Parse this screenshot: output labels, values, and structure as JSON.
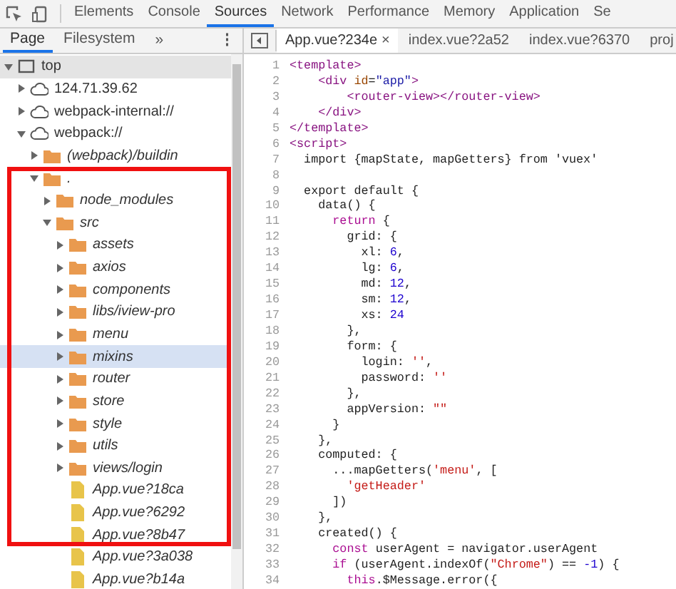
{
  "main_tabs": [
    {
      "label": "Elements",
      "selected": false
    },
    {
      "label": "Console",
      "selected": false
    },
    {
      "label": "Sources",
      "selected": true
    },
    {
      "label": "Network",
      "selected": false
    },
    {
      "label": "Performance",
      "selected": false
    },
    {
      "label": "Memory",
      "selected": false
    },
    {
      "label": "Application",
      "selected": false
    },
    {
      "label": "Se",
      "selected": false
    }
  ],
  "navigator_tabs": [
    {
      "label": "Page",
      "selected": true
    },
    {
      "label": "Filesystem",
      "selected": false
    }
  ],
  "navigator_more": "»",
  "navigator_menu": "⋮",
  "editor_tabs": [
    {
      "label": "App.vue?234e",
      "close": "×",
      "selected": true
    },
    {
      "label": "index.vue?2a52",
      "selected": false
    },
    {
      "label": "index.vue?6370",
      "selected": false
    },
    {
      "label": "proj",
      "selected": false
    }
  ],
  "tree": [
    {
      "name": "top",
      "kind": "frame",
      "italic": false,
      "expanded": true,
      "selected": false,
      "hovered": true,
      "children": [
        {
          "name": "124.71.39.62",
          "kind": "domain",
          "italic": false,
          "expanded": false,
          "selected": false,
          "hovered": false
        },
        {
          "name": "webpack-internal://",
          "kind": "domain",
          "italic": false,
          "expanded": false,
          "selected": false,
          "hovered": false
        },
        {
          "name": "webpack://",
          "kind": "domain",
          "italic": false,
          "expanded": true,
          "selected": false,
          "hovered": false,
          "children": [
            {
              "name": "(webpack)/buildin",
              "kind": "folder",
              "italic": true,
              "expanded": false,
              "selected": false,
              "hovered": false
            },
            {
              "name": ".",
              "kind": "folder",
              "italic": true,
              "expanded": true,
              "selected": false,
              "hovered": false,
              "children": [
                {
                  "name": "node_modules",
                  "kind": "folder",
                  "italic": true,
                  "expanded": false,
                  "selected": false,
                  "hovered": false
                },
                {
                  "name": "src",
                  "kind": "folder",
                  "italic": true,
                  "expanded": true,
                  "selected": false,
                  "hovered": false,
                  "children": [
                    {
                      "name": "assets",
                      "kind": "folder",
                      "italic": true,
                      "expanded": false,
                      "selected": false,
                      "hovered": false
                    },
                    {
                      "name": "axios",
                      "kind": "folder",
                      "italic": true,
                      "expanded": false,
                      "selected": false,
                      "hovered": false
                    },
                    {
                      "name": "components",
                      "kind": "folder",
                      "italic": true,
                      "expanded": false,
                      "selected": false,
                      "hovered": false
                    },
                    {
                      "name": "libs/iview-pro",
                      "kind": "folder",
                      "italic": true,
                      "expanded": false,
                      "selected": false,
                      "hovered": false
                    },
                    {
                      "name": "menu",
                      "kind": "folder",
                      "italic": true,
                      "expanded": false,
                      "selected": false,
                      "hovered": false
                    },
                    {
                      "name": "mixins",
                      "kind": "folder",
                      "italic": true,
                      "expanded": false,
                      "selected": true,
                      "hovered": false
                    },
                    {
                      "name": "router",
                      "kind": "folder",
                      "italic": true,
                      "expanded": false,
                      "selected": false,
                      "hovered": false
                    },
                    {
                      "name": "store",
                      "kind": "folder",
                      "italic": true,
                      "expanded": false,
                      "selected": false,
                      "hovered": false
                    },
                    {
                      "name": "style",
                      "kind": "folder",
                      "italic": true,
                      "expanded": false,
                      "selected": false,
                      "hovered": false
                    },
                    {
                      "name": "utils",
                      "kind": "folder",
                      "italic": true,
                      "expanded": false,
                      "selected": false,
                      "hovered": false
                    },
                    {
                      "name": "views/login",
                      "kind": "folder",
                      "italic": true,
                      "expanded": false,
                      "selected": false,
                      "hovered": false
                    },
                    {
                      "name": "App.vue?18ca",
                      "kind": "file",
                      "italic": true,
                      "selected": false,
                      "hovered": false
                    },
                    {
                      "name": "App.vue?6292",
                      "kind": "file",
                      "italic": true,
                      "selected": false,
                      "hovered": false
                    },
                    {
                      "name": "App.vue?8b47",
                      "kind": "file",
                      "italic": true,
                      "selected": false,
                      "hovered": false
                    },
                    {
                      "name": "App.vue?3a038",
                      "kind": "file",
                      "italic": true,
                      "selected": false,
                      "hovered": false
                    },
                    {
                      "name": "App.vue?b14a",
                      "kind": "file",
                      "italic": true,
                      "selected": false,
                      "hovered": false
                    }
                  ]
                }
              ]
            }
          ]
        }
      ]
    }
  ],
  "annotation": {
    "kind": "red_frame"
  },
  "code_lines": [
    {
      "number": "1",
      "tokens": [
        {
          "text": "<template>",
          "kind": "tag"
        }
      ]
    },
    {
      "number": "2",
      "tokens": [
        {
          "text": "    <div ",
          "kind": "tag"
        },
        {
          "text": "id",
          "kind": "attr"
        },
        {
          "text": "=",
          "kind": "plain"
        },
        {
          "text": "\"app\"",
          "kind": "value"
        },
        {
          "text": ">",
          "kind": "tag"
        }
      ]
    },
    {
      "number": "3",
      "tokens": [
        {
          "text": "        <router-view></router-view>",
          "kind": "tag"
        }
      ]
    },
    {
      "number": "4",
      "tokens": [
        {
          "text": "    </div>",
          "kind": "tag"
        }
      ]
    },
    {
      "number": "5",
      "tokens": [
        {
          "text": "</template>",
          "kind": "tag"
        }
      ]
    },
    {
      "number": "6",
      "tokens": [
        {
          "text": "<script>",
          "kind": "tag"
        }
      ]
    },
    {
      "number": "7",
      "tokens": [
        {
          "text": "  import {mapState, mapGetters} from 'vuex'",
          "kind": "plain"
        }
      ]
    },
    {
      "number": "8"
    },
    {
      "number": "9",
      "tokens": [
        {
          "text": "  export default {",
          "kind": "plain"
        }
      ]
    },
    {
      "number": "10",
      "tokens": [
        {
          "text": "    data() {",
          "kind": "plain"
        }
      ]
    },
    {
      "number": "11",
      "tokens": [
        {
          "text": "      return",
          "kind": "keyword"
        },
        {
          "text": " {",
          "kind": "plain"
        }
      ]
    },
    {
      "number": "12",
      "tokens": [
        {
          "text": "        grid: {",
          "kind": "plain"
        }
      ]
    },
    {
      "number": "13",
      "tokens": [
        {
          "text": "          xl: ",
          "kind": "plain"
        },
        {
          "text": "6",
          "kind": "number"
        },
        {
          "text": ",",
          "kind": "plain"
        }
      ]
    },
    {
      "number": "14",
      "tokens": [
        {
          "text": "          lg: ",
          "kind": "plain"
        },
        {
          "text": "6",
          "kind": "number"
        },
        {
          "text": ",",
          "kind": "plain"
        }
      ]
    },
    {
      "number": "15",
      "tokens": [
        {
          "text": "          md: ",
          "kind": "plain"
        },
        {
          "text": "12",
          "kind": "number"
        },
        {
          "text": ",",
          "kind": "plain"
        }
      ]
    },
    {
      "number": "16",
      "tokens": [
        {
          "text": "          sm: ",
          "kind": "plain"
        },
        {
          "text": "12",
          "kind": "number"
        },
        {
          "text": ",",
          "kind": "plain"
        }
      ]
    },
    {
      "number": "17",
      "tokens": [
        {
          "text": "          xs: ",
          "kind": "plain"
        },
        {
          "text": "24",
          "kind": "number"
        }
      ]
    },
    {
      "number": "18",
      "tokens": [
        {
          "text": "        },",
          "kind": "plain"
        }
      ]
    },
    {
      "number": "19",
      "tokens": [
        {
          "text": "        form: {",
          "kind": "plain"
        }
      ]
    },
    {
      "number": "20",
      "tokens": [
        {
          "text": "          login: ",
          "kind": "plain"
        },
        {
          "text": "''",
          "kind": "string"
        },
        {
          "text": ",",
          "kind": "plain"
        }
      ]
    },
    {
      "number": "21",
      "tokens": [
        {
          "text": "          password: ",
          "kind": "plain"
        },
        {
          "text": "''",
          "kind": "string"
        }
      ]
    },
    {
      "number": "22",
      "tokens": [
        {
          "text": "        },",
          "kind": "plain"
        }
      ]
    },
    {
      "number": "23",
      "tokens": [
        {
          "text": "        appVersion: ",
          "kind": "plain"
        },
        {
          "text": "\"\"",
          "kind": "string"
        }
      ]
    },
    {
      "number": "24",
      "tokens": [
        {
          "text": "      }",
          "kind": "plain"
        }
      ]
    },
    {
      "number": "25",
      "tokens": [
        {
          "text": "    },",
          "kind": "plain"
        }
      ]
    },
    {
      "number": "26",
      "tokens": [
        {
          "text": "    computed: {",
          "kind": "plain"
        }
      ]
    },
    {
      "number": "27",
      "tokens": [
        {
          "text": "      ...mapGetters(",
          "kind": "plain"
        },
        {
          "text": "'menu'",
          "kind": "string"
        },
        {
          "text": ", [",
          "kind": "plain"
        }
      ]
    },
    {
      "number": "28",
      "tokens": [
        {
          "text": "        'getHeader'",
          "kind": "string"
        }
      ]
    },
    {
      "number": "29",
      "tokens": [
        {
          "text": "      ])",
          "kind": "plain"
        }
      ]
    },
    {
      "number": "30",
      "tokens": [
        {
          "text": "    },",
          "kind": "plain"
        }
      ]
    },
    {
      "number": "31",
      "tokens": [
        {
          "text": "    created() {",
          "kind": "plain"
        }
      ]
    },
    {
      "number": "32",
      "tokens": [
        {
          "text": "      const",
          "kind": "keyword"
        },
        {
          "text": " userAgent = navigator.userAgent",
          "kind": "plain"
        }
      ]
    },
    {
      "number": "33",
      "tokens": [
        {
          "text": "      if",
          "kind": "keyword"
        },
        {
          "text": " (userAgent.indexOf(",
          "kind": "plain"
        },
        {
          "text": "\"Chrome\"",
          "kind": "string"
        },
        {
          "text": ") == ",
          "kind": "plain"
        },
        {
          "text": "-1",
          "kind": "number"
        },
        {
          "text": ") {",
          "kind": "plain"
        }
      ]
    },
    {
      "number": "34",
      "tokens": [
        {
          "text": "        this",
          "kind": "keyword"
        },
        {
          "text": ".$Message.error({",
          "kind": "plain"
        }
      ]
    }
  ]
}
